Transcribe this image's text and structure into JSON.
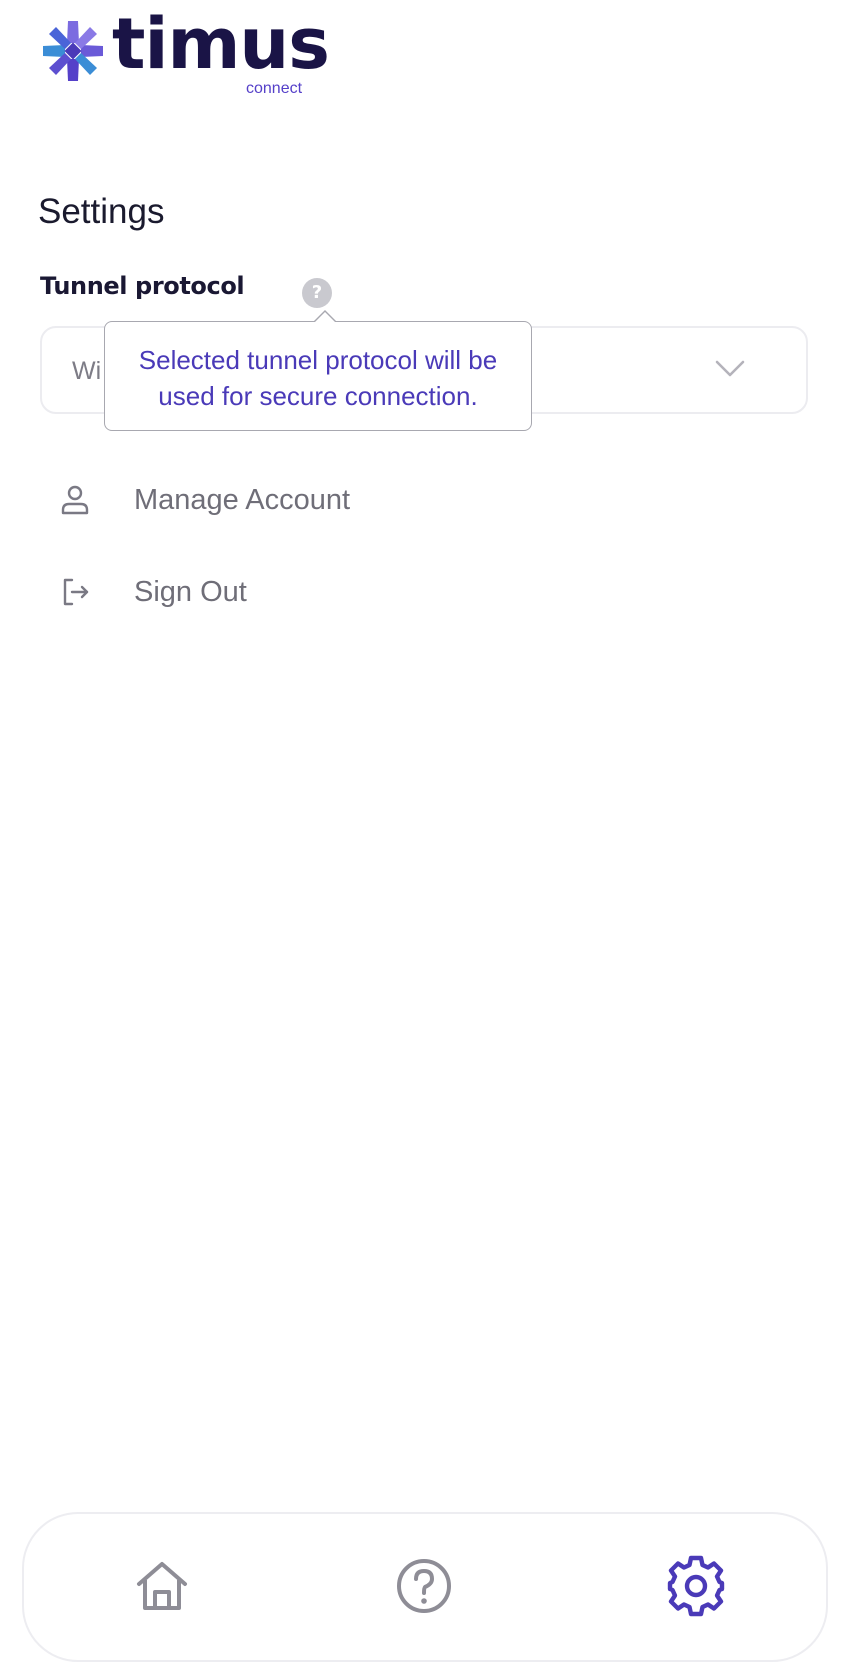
{
  "app": {
    "brand_name": "timus",
    "brand_sub": "connect",
    "brand_colors": [
      "#5540c9",
      "#7b6be0",
      "#3b8dd6",
      "#1a1446"
    ]
  },
  "page": {
    "title": "Settings"
  },
  "tunnel": {
    "label": "Tunnel protocol",
    "help_icon": "?",
    "selected_value": "Wi",
    "tooltip": {
      "line1": "Selected tunnel protocol will be",
      "line2": "used for secure connection."
    }
  },
  "menu": {
    "items": [
      {
        "label": "Manage Account",
        "icon": "user-icon"
      },
      {
        "label": "Sign Out",
        "icon": "sign-out-icon"
      }
    ]
  },
  "nav": {
    "items": [
      {
        "name": "home",
        "icon": "home-icon",
        "active": false
      },
      {
        "name": "help",
        "icon": "help-circle-icon",
        "active": false
      },
      {
        "name": "settings",
        "icon": "gear-icon",
        "active": true
      }
    ],
    "active_color": "#4a3ab8",
    "inactive_color": "#8e8d96"
  }
}
